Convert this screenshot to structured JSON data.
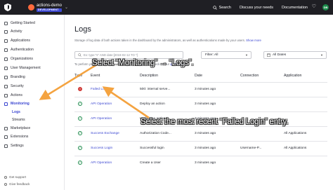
{
  "topbar": {
    "tenant_name": "actions-demo",
    "tenant_badge": "DEVELOPMENT",
    "nav": [
      "Search",
      "Discuss your needs",
      "Documentation"
    ],
    "user_initials": "DB"
  },
  "sidebar": {
    "items": [
      {
        "label": "Getting Started",
        "icon": "rocket-icon"
      },
      {
        "label": "Activity",
        "icon": "activity-icon"
      },
      {
        "label": "Applications",
        "icon": "applications-icon"
      },
      {
        "label": "Authentication",
        "icon": "authentication-icon"
      },
      {
        "label": "Organizations",
        "icon": "organizations-icon"
      },
      {
        "label": "User Management",
        "icon": "users-icon"
      },
      {
        "label": "Branding",
        "icon": "branding-icon"
      },
      {
        "label": "Security",
        "icon": "shield-icon"
      },
      {
        "label": "Actions",
        "icon": "actions-icon"
      },
      {
        "label": "Monitoring",
        "icon": "monitoring-icon"
      }
    ],
    "sub_items": [
      "Logs",
      "Streams"
    ],
    "bottom_items": [
      {
        "label": "Marketplace",
        "icon": "marketplace-icon"
      },
      {
        "label": "Extensions",
        "icon": "extensions-icon"
      },
      {
        "label": "Settings",
        "icon": "gear-icon"
      }
    ],
    "footer": [
      "Get support",
      "Give feedback"
    ]
  },
  "main": {
    "title": "Logs",
    "description": "Storage of log data of both actions taken in the dashboard by the administrators, as well as authentications made by your users.",
    "show_more": "Show more",
    "search_placeholder": "Ex: type:\"s\" AND date:[2019-02-12 TO *]",
    "filter_label": "Filter: All",
    "date_label": "All Dates",
    "hint_prefix": "To perform your search, press",
    "hint_key": "enter",
    "hint_suffix": ". Need help querying? Check out our",
    "hint_link": "query syntax",
    "columns": [
      "Type",
      "Event",
      "Description",
      "Date",
      "Connection",
      "Application"
    ],
    "rows": [
      {
        "status": "fail",
        "event": "Failed Login",
        "description": "500: internal serve...",
        "date": "3 minutes ago",
        "connection": "",
        "application": ""
      },
      {
        "status": "ok",
        "event": "API Operation",
        "description": "Deploy an action",
        "date": "3 minutes ago",
        "connection": "",
        "application": ""
      },
      {
        "status": "ok",
        "event": "API Operation",
        "description": "Update an action",
        "date": "3 minutes ago",
        "connection": "",
        "application": ""
      },
      {
        "status": "ok",
        "event": "Success Exchange",
        "description": "Authorization Code...",
        "date": "3 minutes ago",
        "connection": "",
        "application": "All Applications"
      },
      {
        "status": "ok",
        "event": "Success Login",
        "description": "Successful login",
        "date": "3 minutes ago",
        "connection": "Username-P...",
        "application": "All Applications"
      },
      {
        "status": "ok",
        "event": "API Operation",
        "description": "Create a User",
        "date": "3 minutes ago",
        "connection": "",
        "application": ""
      }
    ]
  },
  "callouts": {
    "first": "Select “Monitoring” → “Logs”.",
    "second": "Select the most recent “Failed Login” entry."
  },
  "colors": {
    "accent": "#3c47d1",
    "arrow": "#f4a340",
    "fail": "#d03c38",
    "success": "#1b8a4a"
  }
}
